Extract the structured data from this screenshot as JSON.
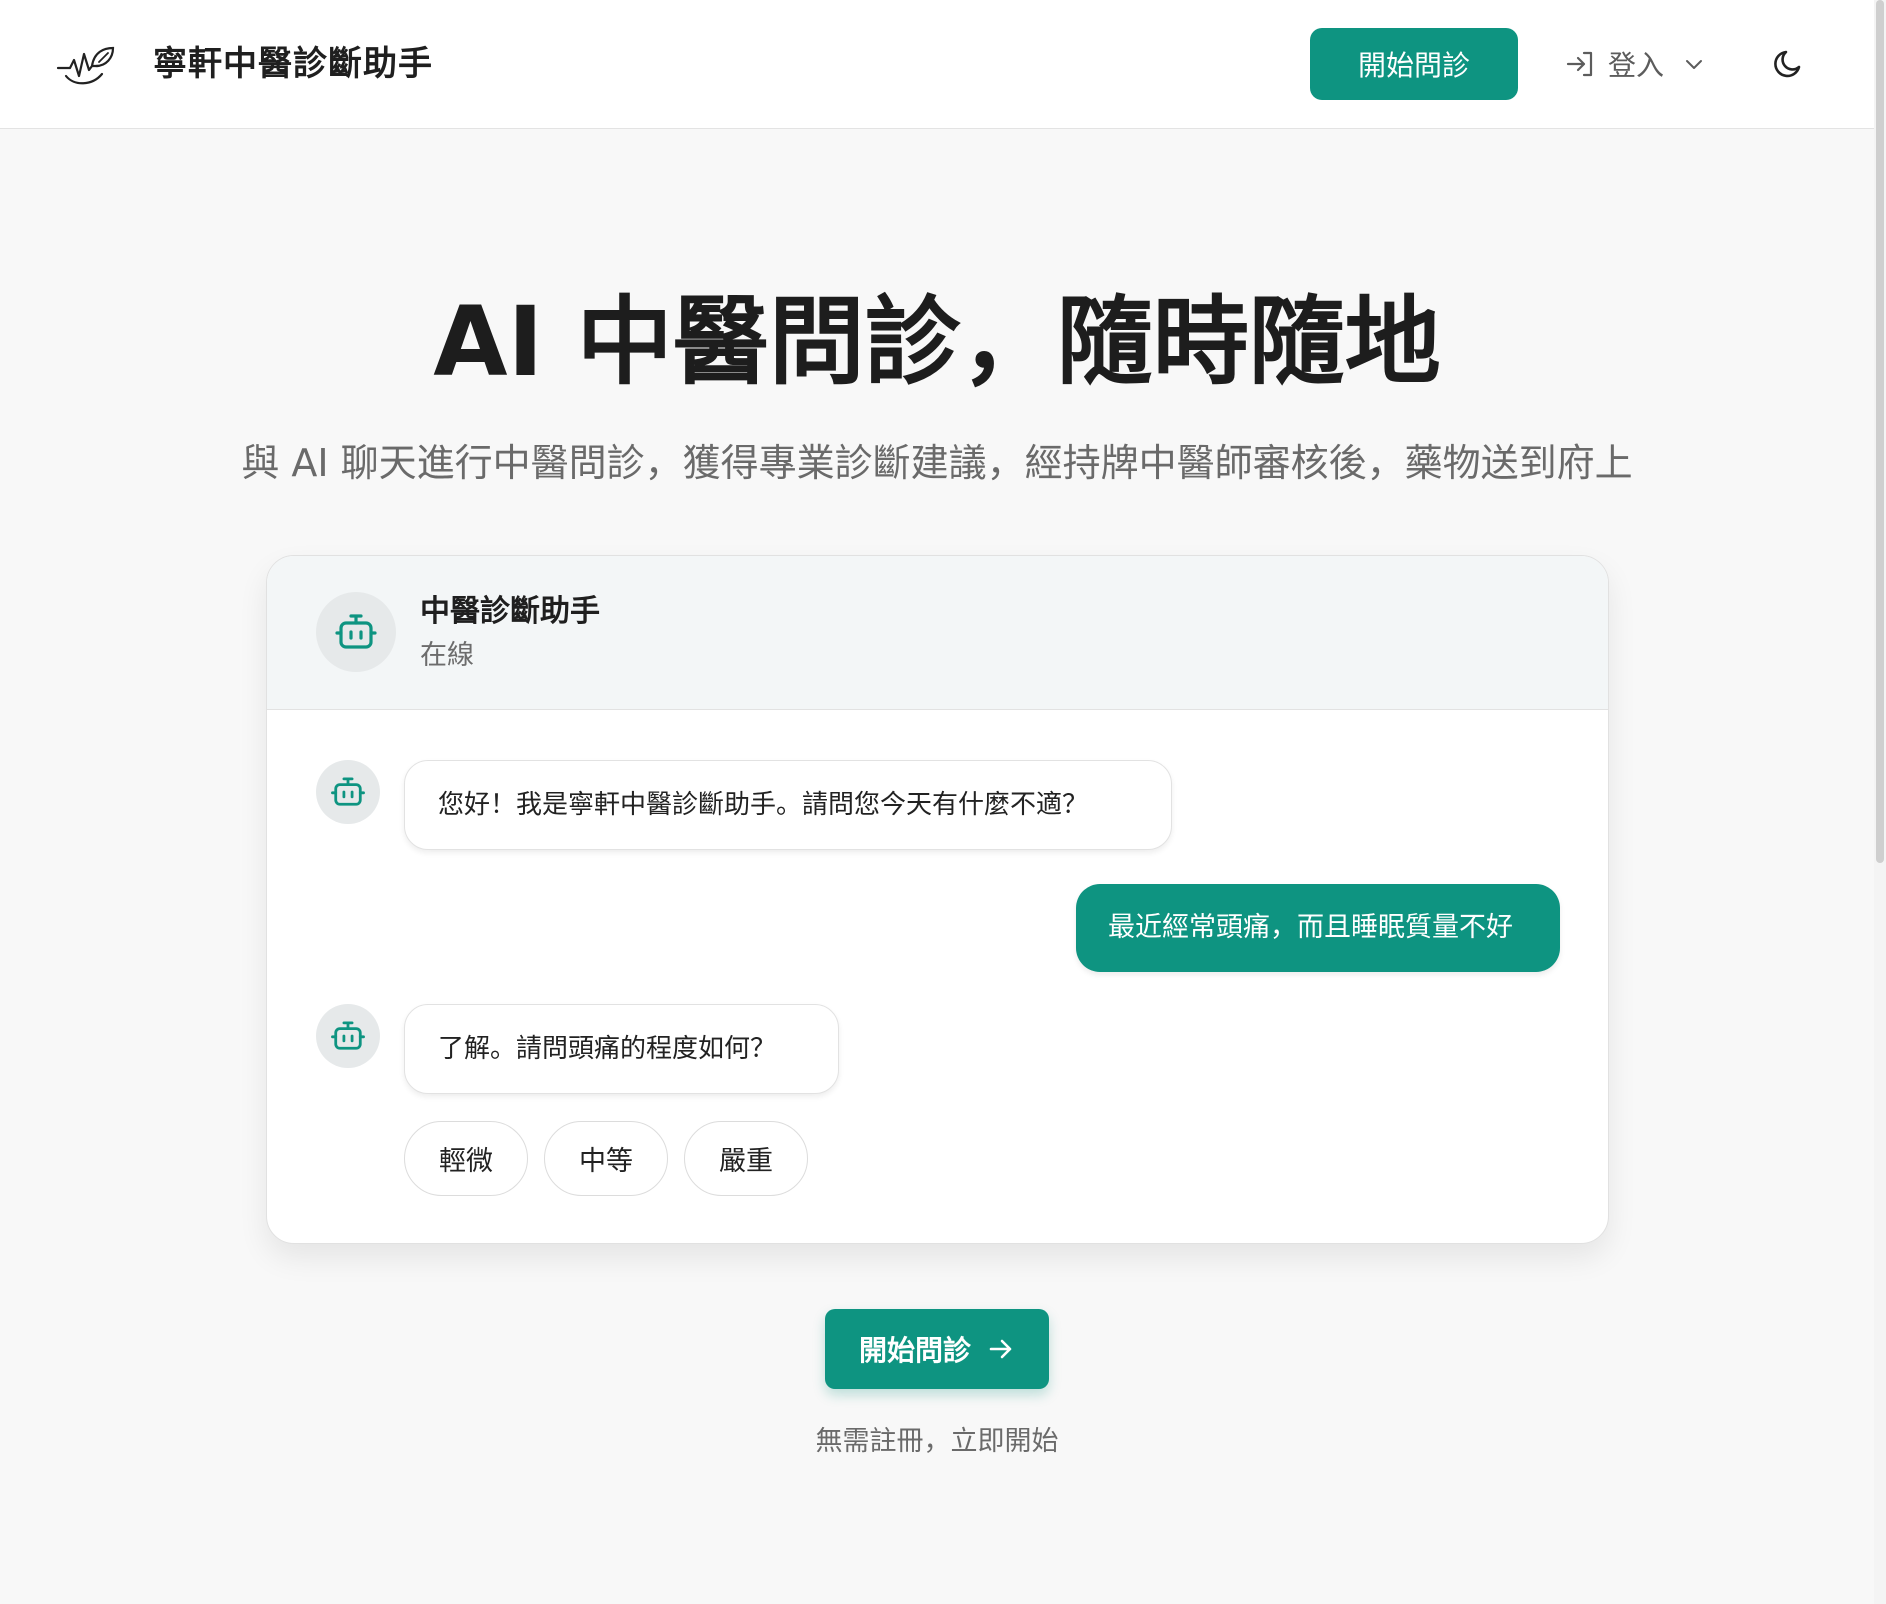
{
  "header": {
    "brand": "寧軒中醫診斷助手",
    "start_button": "開始問診",
    "login_label": "登入",
    "icons": {
      "logo": "heartbeat-leaf-logo",
      "login": "login-arrow-icon",
      "dropdown": "chevron-down-icon",
      "theme": "moon-icon"
    }
  },
  "hero": {
    "title": "AI 中醫問診，隨時隨地",
    "subtitle": "與 AI 聊天進行中醫問診，獲得專業診斷建議，經持牌中醫師審核後，藥物送到府上"
  },
  "chat": {
    "assistant_name": "中醫診斷助手",
    "status": "在線",
    "messages": [
      {
        "role": "bot",
        "text": "您好！我是寧軒中醫診斷助手。請問您今天有什麼不適？"
      },
      {
        "role": "user",
        "text": "最近經常頭痛，而且睡眠質量不好"
      },
      {
        "role": "bot",
        "text": "了解。請問頭痛的程度如何？"
      }
    ],
    "options": [
      "輕微",
      "中等",
      "嚴重"
    ]
  },
  "cta": {
    "button": "開始問診",
    "note": "無需註冊，立即開始"
  },
  "colors": {
    "accent": "#0e9481",
    "background": "#f8f8f8"
  }
}
